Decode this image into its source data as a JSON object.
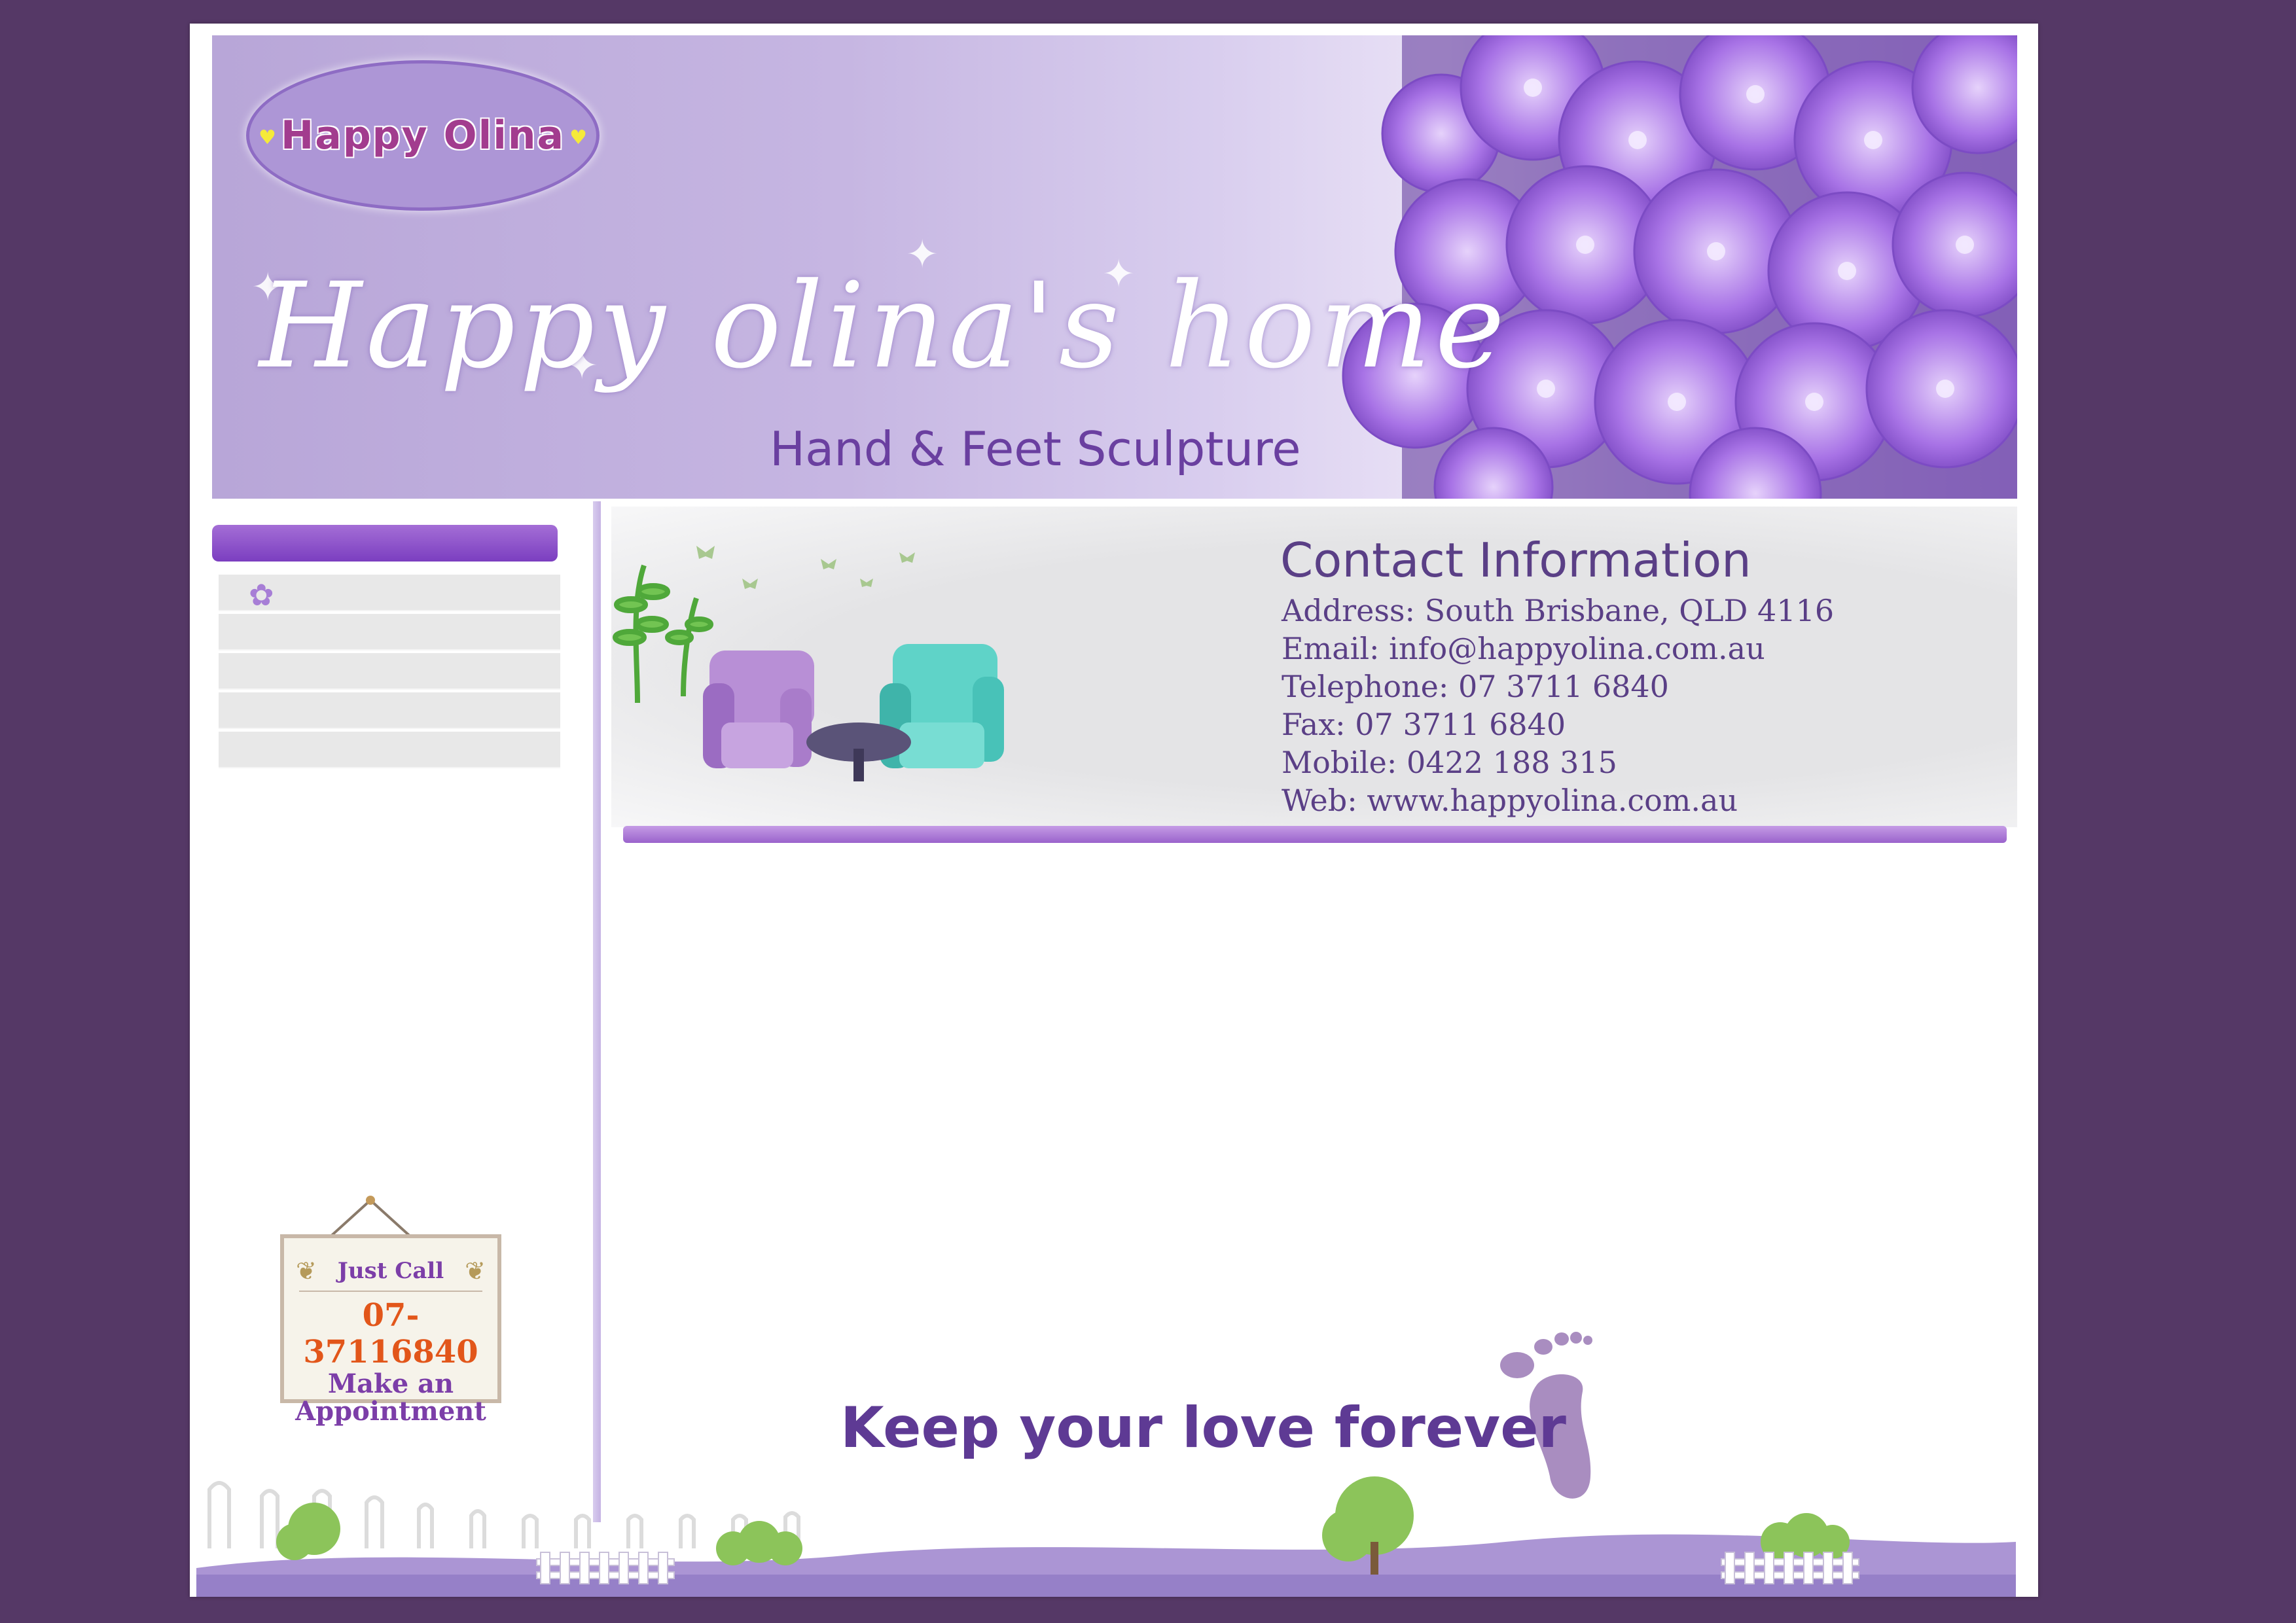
{
  "header": {
    "logo_text": "Happy Olina",
    "title": "Happy olina's home",
    "subtitle": "Hand & Feet Sculpture"
  },
  "sidebar": {
    "items": [
      "",
      "",
      "",
      "",
      ""
    ]
  },
  "contact": {
    "heading": "Contact Information",
    "lines": [
      "Address: South Brisbane, QLD 4116",
      "Email: info@happyolina.com.au",
      "Telephone: 07 3711 6840",
      "Fax: 07 3711 6840",
      "Mobile: 0422 188 315",
      "Web: www.happyolina.com.au"
    ]
  },
  "call_sign": {
    "just_call": "Just Call",
    "phone": "07-37116840",
    "make_an": "Make an",
    "appointment": "Appointment"
  },
  "footer": {
    "tagline": "Keep your love forever"
  },
  "colors": {
    "background": "#553866",
    "accent_purple": "#7b3ec0",
    "text_purple": "#5a3f86",
    "phone_orange": "#e2561a"
  },
  "icons": [
    "heart-icon",
    "flower-bullet-icon",
    "sofa-illustration",
    "footprint-icon"
  ]
}
